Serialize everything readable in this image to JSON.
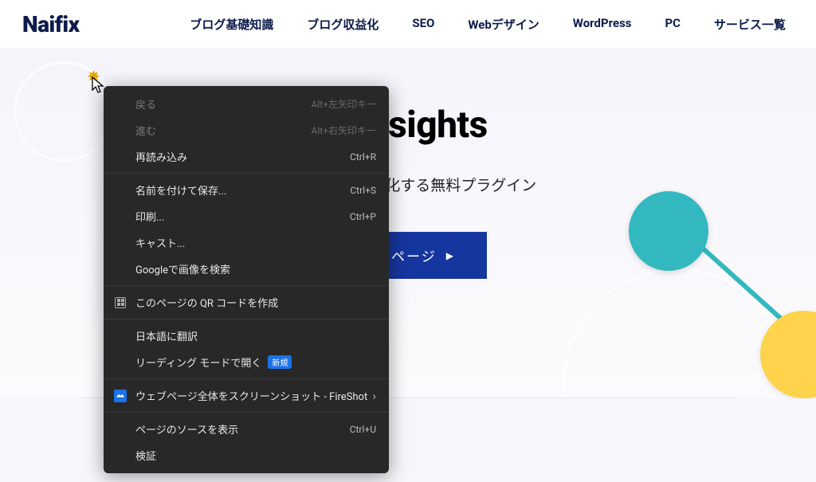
{
  "header": {
    "logo": "Naifix",
    "nav": [
      "ブログ基礎知識",
      "ブログ収益化",
      "SEO",
      "Webデザイン",
      "WordPress",
      "PC",
      "サービス一覧"
    ]
  },
  "hero": {
    "title_visible_fragment": "p Insights",
    "subtitle_visible_fragment": "分析してマップ化する無料プラグイン",
    "cta_visible_fragment": "ードページ",
    "cta_arrow": "▶"
  },
  "context_menu": {
    "back": {
      "label": "戻る",
      "shortcut": "Alt+左矢印キー"
    },
    "forward": {
      "label": "進む",
      "shortcut": "Alt+右矢印キー"
    },
    "reload": {
      "label": "再読み込み",
      "shortcut": "Ctrl+R"
    },
    "save_as": {
      "label": "名前を付けて保存...",
      "shortcut": "Ctrl+S"
    },
    "print": {
      "label": "印刷...",
      "shortcut": "Ctrl+P"
    },
    "cast": {
      "label": "キャスト..."
    },
    "search_image": {
      "label": "Googleで画像を検索"
    },
    "qr": {
      "label": "このページの QR コードを作成"
    },
    "translate": {
      "label": "日本語に翻訳"
    },
    "reader": {
      "label": "リーディング モードで開く",
      "badge": "新規"
    },
    "fireshot": {
      "label": "ウェブページ全体をスクリーンショット - FireShot"
    },
    "view_source": {
      "label": "ページのソースを表示",
      "shortcut": "Ctrl+U"
    },
    "inspect": {
      "label": "検証"
    }
  }
}
